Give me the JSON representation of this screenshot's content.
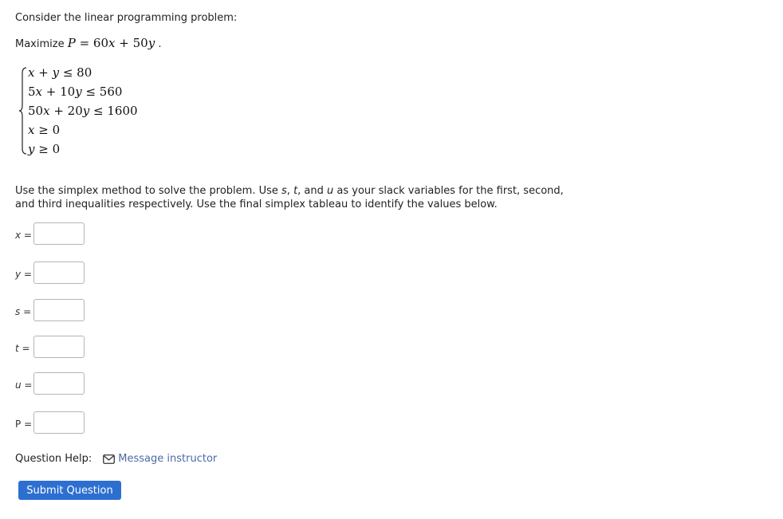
{
  "question": {
    "intro": "Consider the linear programming problem:",
    "maximize_word": "Maximize",
    "objective": {
      "var": "P",
      "eq": " = 60",
      "x": "x",
      "plus": " + 50",
      "y": "y",
      "end": " ."
    },
    "constraints": [
      {
        "a": "x",
        "op1": " + ",
        "b": "y",
        "rest": " ≤ 80"
      },
      {
        "pre": "5",
        "a": "x",
        "mid": " + 10",
        "b": "y",
        "rest": " ≤ 560"
      },
      {
        "pre": "50",
        "a": "x",
        "mid": " + 20",
        "b": "y",
        "rest": " ≤ 1600"
      },
      {
        "a": "x",
        "rest": " ≥ 0"
      },
      {
        "a": "y",
        "rest": " ≥ 0"
      }
    ],
    "instructions": {
      "p1": "Use the simplex method to solve the problem. Use ",
      "s": "s",
      "c1": ", ",
      "t": "t",
      "c2": ", and ",
      "u": "u",
      "p2": " as your slack variables for the first, second, and third inequalities respectively. Use the final simplex tableau to identify the values below."
    },
    "answers": [
      {
        "var": "x",
        "eq": " =",
        "value": ""
      },
      {
        "var": "y",
        "eq": " =",
        "value": ""
      },
      {
        "var": "s",
        "eq": " =",
        "value": ""
      },
      {
        "var": "t",
        "eq": " =",
        "value": ""
      },
      {
        "var": "u",
        "eq": " =",
        "value": ""
      },
      {
        "var": "P",
        "eq": " =",
        "value": ""
      }
    ]
  },
  "help": {
    "label": "Question Help:",
    "icon": "envelope-icon",
    "link_text": "Message instructor"
  },
  "submit_label": "Submit Question",
  "colors": {
    "link": "#4a6aa5",
    "button": "#2d6fd1"
  }
}
